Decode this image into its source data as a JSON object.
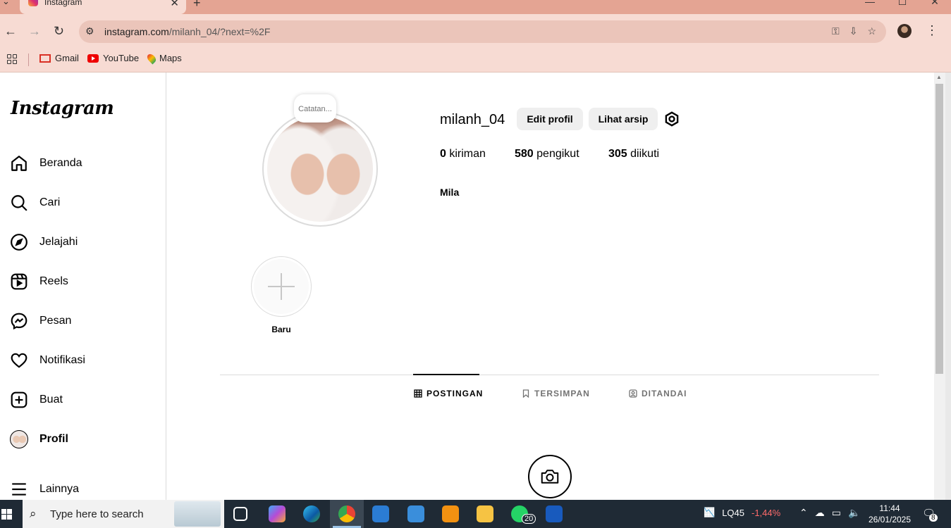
{
  "browser": {
    "tab_title": "Instagram",
    "url_host": "instagram.com",
    "url_path": "/milanh_04/?next=%2F",
    "bookmarks": [
      {
        "label": "Gmail",
        "icon": "gmail-icon"
      },
      {
        "label": "YouTube",
        "icon": "youtube-icon"
      },
      {
        "label": "Maps",
        "icon": "maps-icon"
      }
    ]
  },
  "sidebar": {
    "logo": "Instagram",
    "items": [
      {
        "label": "Beranda",
        "icon": "home-icon"
      },
      {
        "label": "Cari",
        "icon": "search-icon"
      },
      {
        "label": "Jelajahi",
        "icon": "compass-icon"
      },
      {
        "label": "Reels",
        "icon": "reels-icon"
      },
      {
        "label": "Pesan",
        "icon": "messenger-icon"
      },
      {
        "label": "Notifikasi",
        "icon": "heart-icon"
      },
      {
        "label": "Buat",
        "icon": "create-icon"
      },
      {
        "label": "Profil",
        "icon": "avatar"
      },
      {
        "label": "Lainnya",
        "icon": "menu-icon"
      }
    ]
  },
  "profile": {
    "note": "Catatan...",
    "username": "milanh_04",
    "edit_button": "Edit profil",
    "archive_button": "Lihat arsip",
    "stats": {
      "posts_count": "0",
      "posts_label": "kiriman",
      "followers_count": "580",
      "followers_label": "pengikut",
      "following_count": "305",
      "following_label": "diikuti"
    },
    "full_name": "Mila",
    "new_highlight_label": "Baru",
    "tabs": [
      {
        "label": "POSTINGAN",
        "active": true
      },
      {
        "label": "TERSIMPAN",
        "active": false
      },
      {
        "label": "DITANDAI",
        "active": false
      }
    ]
  },
  "taskbar": {
    "search_placeholder": "Type here to search",
    "whatsapp_badge": "20",
    "stock_name": "LQ45",
    "stock_change": "-1,44%",
    "time": "11:44",
    "date": "26/01/2025",
    "notification_count": "8"
  },
  "colors": {
    "chrome_tabstrip": "#e4a493",
    "chrome_toolbar": "#f7dbd3",
    "button_gray": "#efefef",
    "divider": "#dbdbdb",
    "taskbar": "#1f2a35",
    "stock_negative": "#ff6b6b"
  }
}
